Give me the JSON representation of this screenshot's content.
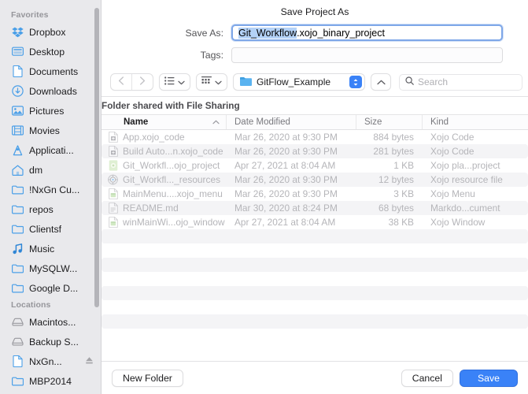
{
  "dialog": {
    "title": "Save Project As",
    "save_as_label": "Save As:",
    "save_as_value_selected": "Git_Workflow",
    "save_as_value_rest": ".xojo_binary_project",
    "tags_label": "Tags:",
    "tags_value": "",
    "banner": "Folder shared with File Sharing",
    "accent_color": "#3a82f7",
    "selection_color": "#b4d2f7"
  },
  "sidebar": {
    "sections": [
      {
        "title": "Favorites",
        "items": [
          {
            "label": "Dropbox",
            "icon": "dropbox-icon"
          },
          {
            "label": "Desktop",
            "icon": "desktop-icon"
          },
          {
            "label": "Documents",
            "icon": "document-icon"
          },
          {
            "label": "Downloads",
            "icon": "downloads-icon"
          },
          {
            "label": "Pictures",
            "icon": "pictures-icon"
          },
          {
            "label": "Movies",
            "icon": "movies-icon"
          },
          {
            "label": "Applicati...",
            "icon": "applications-icon"
          },
          {
            "label": "dm",
            "icon": "home-icon"
          },
          {
            "label": "!NxGn Cu...",
            "icon": "folder-icon"
          },
          {
            "label": "repos",
            "icon": "folder-icon"
          },
          {
            "label": "Clientsf",
            "icon": "folder-icon"
          },
          {
            "label": "Music",
            "icon": "music-icon"
          },
          {
            "label": "MySQLW...",
            "icon": "folder-icon"
          },
          {
            "label": "Google D...",
            "icon": "folder-icon"
          }
        ]
      },
      {
        "title": "Locations",
        "items": [
          {
            "label": "Macintos...",
            "icon": "disk-icon"
          },
          {
            "label": "Backup S...",
            "icon": "disk-icon"
          },
          {
            "label": "NxGn...",
            "icon": "document-icon",
            "eject": true
          },
          {
            "label": "MBP2014",
            "icon": "folder-icon"
          }
        ]
      }
    ]
  },
  "toolbar": {
    "back_icon": "chevron-left-icon",
    "forward_icon": "chevron-right-icon",
    "view_icon": "list-view-icon",
    "group_icon": "group-view-icon",
    "current_folder": "GitFlow_Example",
    "up_icon": "chevron-up-icon",
    "search_placeholder": "Search"
  },
  "filelist": {
    "columns": [
      "Name",
      "Date Modified",
      "Size",
      "Kind"
    ],
    "sort_column": "Name",
    "sort_direction": "ascending",
    "rows": [
      {
        "name": "App.xojo_code",
        "date": "Mar 26, 2020 at 9:30 PM",
        "size": "884 bytes",
        "kind": "Xojo Code",
        "icon": "xojo-code-file-icon"
      },
      {
        "name": "Build Auto...n.xojo_code",
        "date": "Mar 26, 2020 at 9:30 PM",
        "size": "281 bytes",
        "kind": "Xojo Code",
        "icon": "xojo-code-file-icon"
      },
      {
        "name": "Git_Workfl...ojo_project",
        "date": "Apr 27, 2021 at 8:04 AM",
        "size": "1 KB",
        "kind": "Xojo pla...project",
        "icon": "xojo-project-file-icon"
      },
      {
        "name": "Git_Workfl..._resources",
        "date": "Mar 26, 2020 at 9:30 PM",
        "size": "12 bytes",
        "kind": "Xojo resource file",
        "icon": "xojo-resource-file-icon"
      },
      {
        "name": "MainMenu....xojo_menu",
        "date": "Mar 26, 2020 at 9:30 PM",
        "size": "3 KB",
        "kind": "Xojo Menu",
        "icon": "xojo-menu-file-icon"
      },
      {
        "name": "README.md",
        "date": "Mar 30, 2020 at 8:24 PM",
        "size": "68 bytes",
        "kind": "Markdo...cument",
        "icon": "markdown-file-icon"
      },
      {
        "name": "winMainWi...ojo_window",
        "date": "Apr 27, 2021 at 8:04 AM",
        "size": "38 KB",
        "kind": "Xojo Window",
        "icon": "xojo-window-file-icon"
      }
    ],
    "empty_row_count": 8
  },
  "footer": {
    "new_folder_label": "New Folder",
    "cancel_label": "Cancel",
    "save_label": "Save"
  }
}
